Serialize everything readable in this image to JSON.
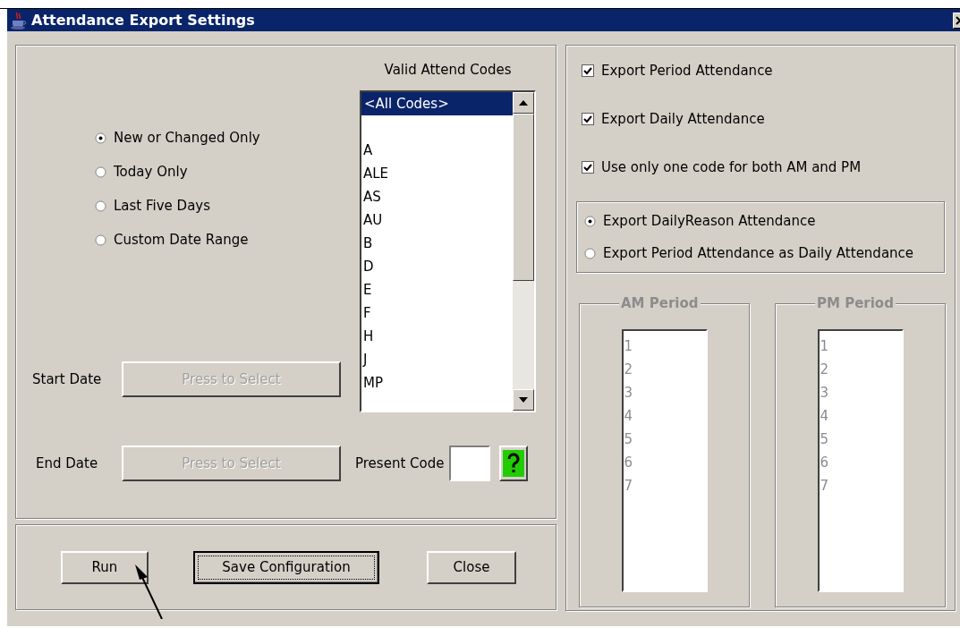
{
  "window": {
    "title": "Attendance Export Settings"
  },
  "date_range": [
    {
      "label": "New or Changed Only",
      "selected": true
    },
    {
      "label": "Today Only",
      "selected": false
    },
    {
      "label": "Last Five Days",
      "selected": false
    },
    {
      "label": "Custom Date Range",
      "selected": false
    }
  ],
  "codes": {
    "heading": "Valid Attend Codes",
    "items": [
      {
        "label": "<All Codes>",
        "selected": true
      },
      {
        "label": "A",
        "selected": false
      },
      {
        "label": "ALE",
        "selected": false
      },
      {
        "label": "AS",
        "selected": false
      },
      {
        "label": "AU",
        "selected": false
      },
      {
        "label": "B",
        "selected": false
      },
      {
        "label": "D",
        "selected": false
      },
      {
        "label": "E",
        "selected": false
      },
      {
        "label": "F",
        "selected": false
      },
      {
        "label": "H",
        "selected": false
      },
      {
        "label": "J",
        "selected": false
      },
      {
        "label": "MP",
        "selected": false
      }
    ]
  },
  "dates": [
    {
      "label": "Start Date",
      "button": "Press to Select",
      "disabled": true
    },
    {
      "label": "End Date",
      "button": "Press to Select",
      "disabled": true
    }
  ],
  "present_code": {
    "label": "Present Code"
  },
  "buttons": [
    {
      "label": "Run",
      "focused": false
    },
    {
      "label": "Save Configuration",
      "focused": true
    },
    {
      "label": "Close",
      "focused": false
    }
  ],
  "options": [
    {
      "label": "Export Period Attendance",
      "checked": true
    },
    {
      "label": "Export Daily Attendance",
      "checked": true
    },
    {
      "label": "Use only one code for both AM and PM",
      "checked": true
    }
  ],
  "daily_mode": [
    {
      "label": "Export DailyReason Attendance",
      "selected": true
    },
    {
      "label": "Export Period Attendance as Daily Attendance",
      "selected": false
    }
  ],
  "periods": [
    {
      "title": "AM Period",
      "disabled": true,
      "items": [
        "1",
        "2",
        "3",
        "4",
        "5",
        "6",
        "7"
      ]
    },
    {
      "title": "PM Period",
      "disabled": true,
      "items": [
        "1",
        "2",
        "3",
        "4",
        "5",
        "6",
        "7"
      ]
    }
  ]
}
